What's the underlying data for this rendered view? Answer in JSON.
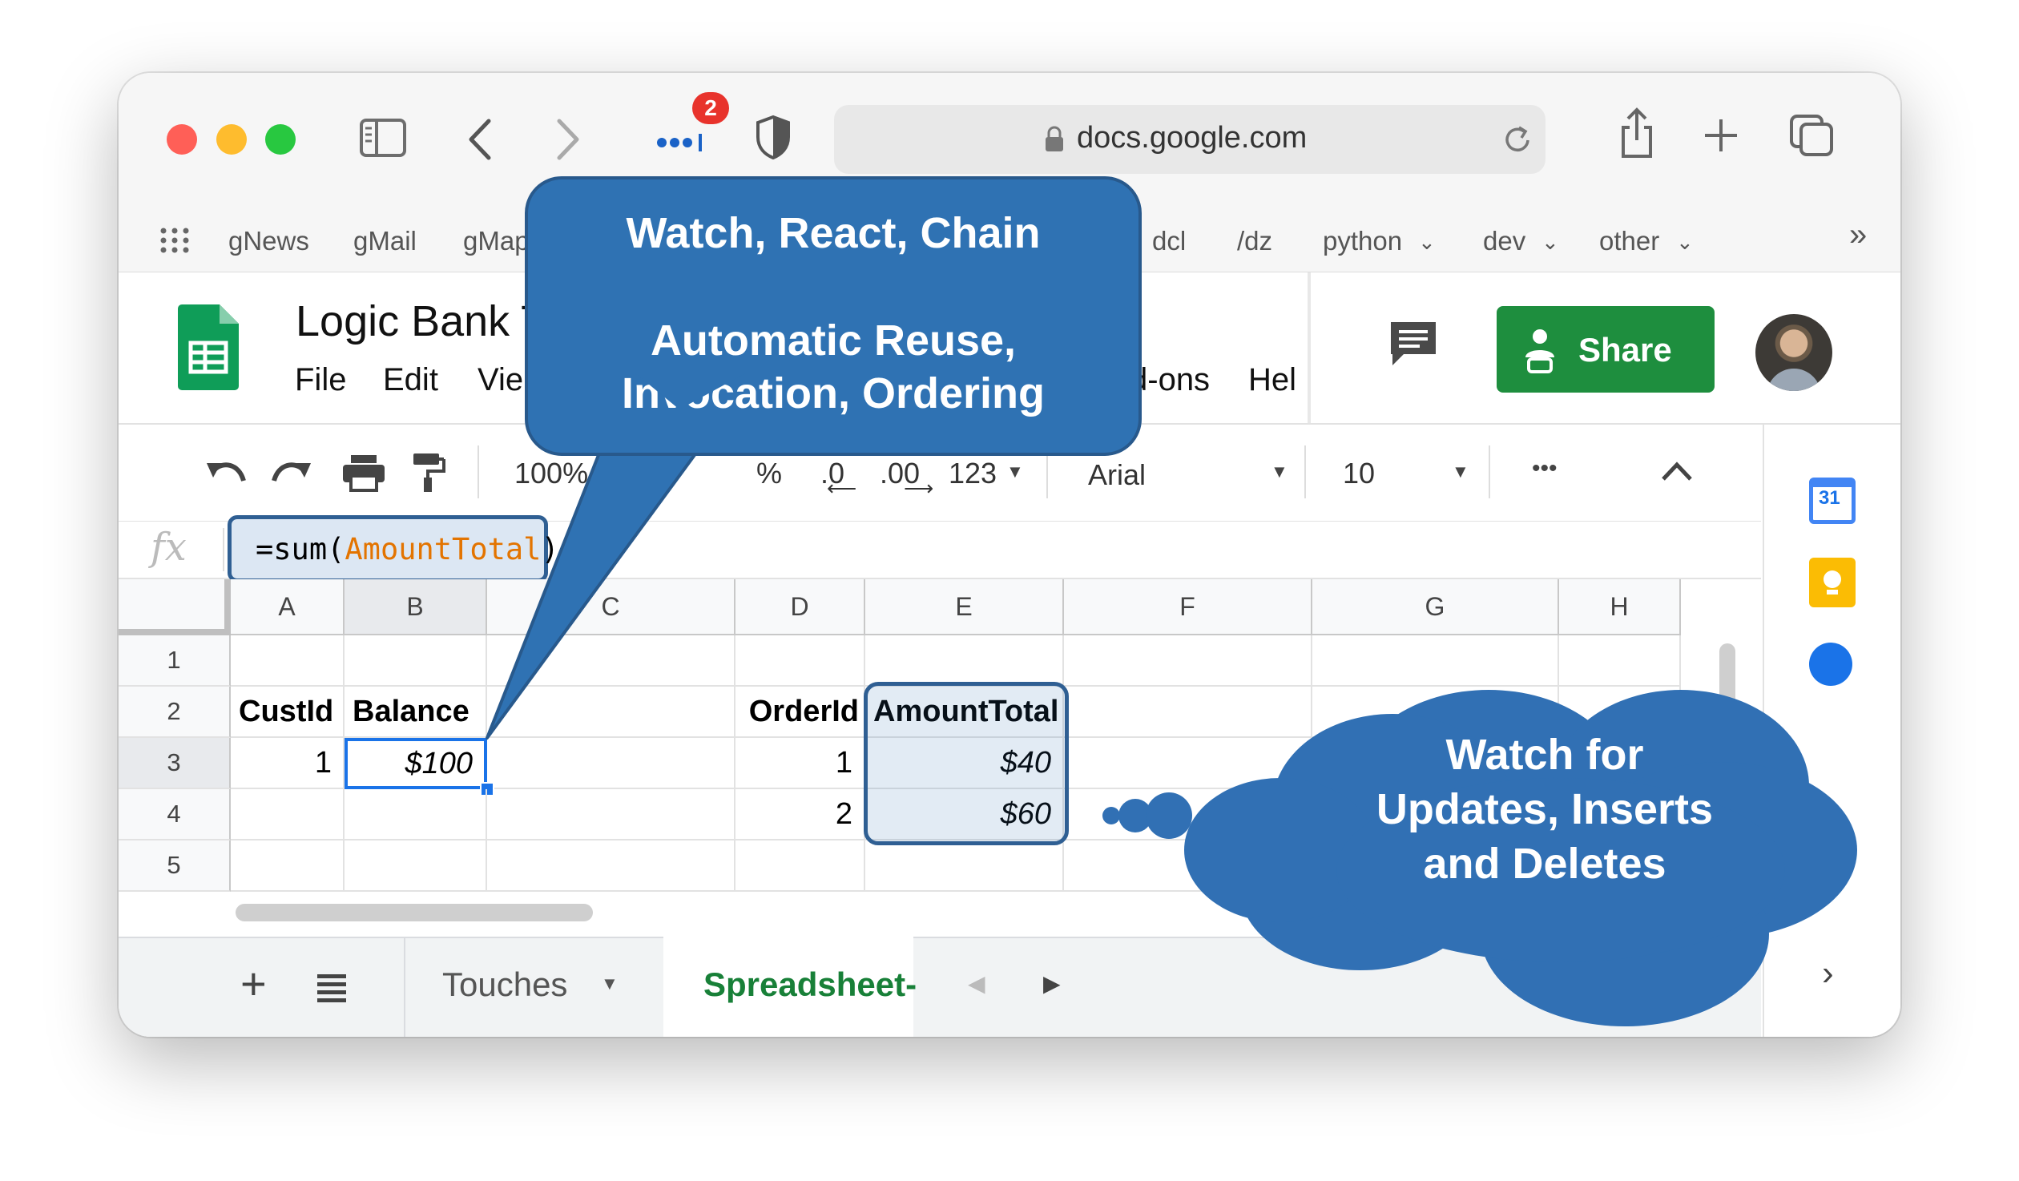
{
  "browser": {
    "url": "docs.google.com",
    "notification_count": "2",
    "bookmarks": [
      "gNews",
      "gMail",
      "gMap",
      "dcl",
      "/dz",
      "python",
      "dev",
      "other"
    ]
  },
  "sheet": {
    "title": "Logic Bank T",
    "menu": [
      "File",
      "Edit",
      "Vie",
      "d-ons",
      "Hel"
    ],
    "share_label": "Share"
  },
  "format_bar": {
    "zoom": "100%",
    "percent": "%",
    "dec_less": ".0",
    "dec_more": ".00",
    "number_format": "123",
    "font": "Arial",
    "font_size": "10",
    "more": "•••"
  },
  "formula_bar": {
    "fx": "fx",
    "prefix": "=sum(",
    "arg": "AmountTotal",
    "suffix": ")"
  },
  "grid": {
    "columns": [
      "A",
      "B",
      "C",
      "D",
      "E",
      "F",
      "G",
      "H"
    ],
    "rows": [
      "1",
      "2",
      "3",
      "4",
      "5"
    ],
    "cells": {
      "A2": "CustId",
      "B2": "Balance",
      "D2": "OrderId",
      "E2": "AmountTotal",
      "A3": "1",
      "B3": "$100",
      "D3": "1",
      "E3": "$40",
      "D4": "2",
      "E4": "$60"
    }
  },
  "tabs": {
    "touches": "Touches",
    "active": "Spreadsheet-"
  },
  "side": {
    "calendar_day": "31"
  },
  "callouts": {
    "speech_line1": "Watch, React, Chain",
    "speech_line2": "Automatic Reuse,",
    "speech_line3": "Invocation, Ordering",
    "cloud_line1": "Watch for",
    "cloud_line2": "Updates, Inserts",
    "cloud_line3": "and Deletes"
  },
  "colors": {
    "callout_blue": "#2f72b3",
    "share_green": "#1e8e3e",
    "sheets_green": "#0f9d58",
    "formula_arg": "#e37400",
    "selection_blue": "#1a73e8",
    "red_light": "#ff5f57",
    "yellow_light": "#febc2e",
    "green_light": "#28c840"
  }
}
